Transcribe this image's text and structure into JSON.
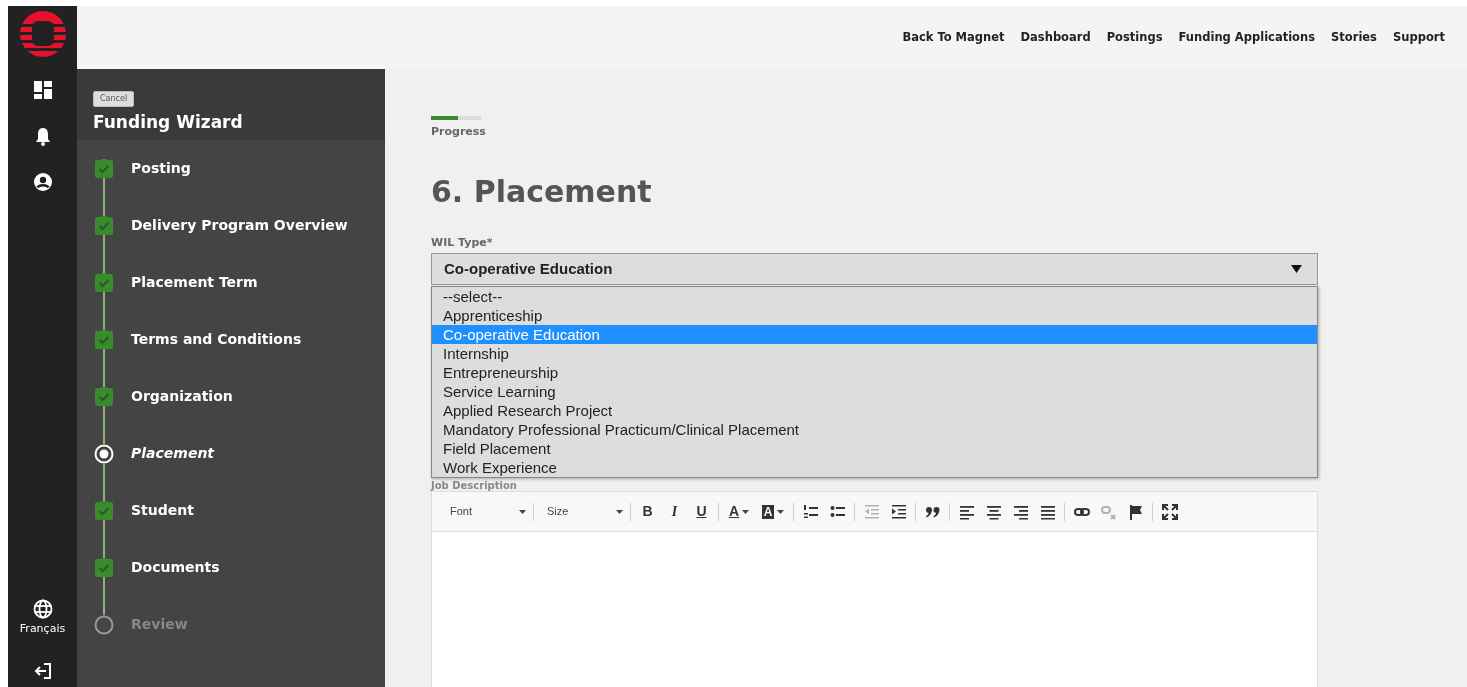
{
  "header": {
    "nav": [
      "Back To Magnet",
      "Dashboard",
      "Postings",
      "Funding Applications",
      "Stories",
      "Support"
    ]
  },
  "rail": {
    "items": [
      {
        "kind": "dashboard"
      },
      {
        "kind": "bell"
      },
      {
        "kind": "account"
      }
    ],
    "language": "Français"
  },
  "wizard": {
    "cancel": "Cancel",
    "title": "Funding Wizard",
    "steps": [
      {
        "label": "Posting",
        "completed": true,
        "selected": false
      },
      {
        "label": "Delivery Program Overview",
        "completed": true,
        "selected": false
      },
      {
        "label": "Placement Term",
        "completed": true,
        "selected": false
      },
      {
        "label": "Terms and Conditions",
        "completed": true,
        "selected": false
      },
      {
        "label": "Organization",
        "completed": true,
        "selected": false
      },
      {
        "label": "Placement",
        "completed": false,
        "selected": true
      },
      {
        "label": "Student",
        "completed": true,
        "selected": false
      },
      {
        "label": "Documents",
        "completed": true,
        "selected": false
      },
      {
        "label": "Review",
        "completed": false,
        "selected": false
      }
    ]
  },
  "progress": {
    "label": "Progress",
    "level": 0.54
  },
  "heading": "6. Placement",
  "wil_type": {
    "label": "WIL Type*",
    "value": "Co-operative Education",
    "expanded": true,
    "options": [
      {
        "label": "--select--",
        "selected": false
      },
      {
        "label": "Apprenticeship",
        "selected": false
      },
      {
        "label": "Co-operative Education",
        "selected": true
      },
      {
        "label": "Internship",
        "selected": false
      },
      {
        "label": "Entrepreneurship",
        "selected": false
      },
      {
        "label": "Service Learning",
        "selected": false
      },
      {
        "label": "Applied Research Project",
        "selected": false
      },
      {
        "label": "Mandatory Professional Practicum/Clinical Placement",
        "selected": false
      },
      {
        "label": "Field Placement",
        "selected": false
      },
      {
        "label": "Work Experience",
        "selected": false
      }
    ]
  },
  "job_description": {
    "label": "Job Description",
    "font": "Font",
    "size": "Size",
    "groups": [
      [
        {
          "kind": "bold",
          "label": "B",
          "disabled": false
        },
        {
          "kind": "italic",
          "label": "I",
          "disabled": false
        },
        {
          "kind": "underline",
          "label": "U",
          "disabled": false
        }
      ],
      [
        {
          "kind": "text-color",
          "label": "A",
          "disabled": false
        },
        {
          "kind": "bg-color",
          "label": "A",
          "disabled": false
        }
      ],
      [
        {
          "kind": "numbered-list",
          "disabled": false
        },
        {
          "kind": "bulleted-list",
          "disabled": false
        }
      ],
      [
        {
          "kind": "outdent",
          "disabled": true
        },
        {
          "kind": "indent",
          "disabled": false
        }
      ],
      [
        {
          "kind": "quote",
          "disabled": false
        }
      ],
      [
        {
          "kind": "align-left",
          "disabled": false
        },
        {
          "kind": "align-center",
          "disabled": false
        },
        {
          "kind": "align-right",
          "disabled": false
        },
        {
          "kind": "justify",
          "disabled": false
        }
      ],
      [
        {
          "kind": "link",
          "disabled": false
        },
        {
          "kind": "unlink",
          "disabled": true
        },
        {
          "kind": "anchor",
          "disabled": false
        }
      ],
      [
        {
          "kind": "maximize",
          "disabled": false
        }
      ]
    ]
  }
}
